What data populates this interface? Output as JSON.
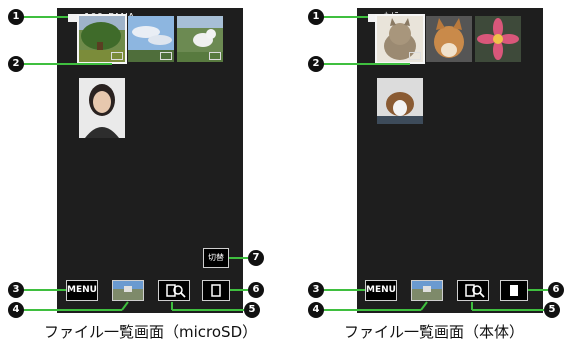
{
  "colors": {
    "leader": "#3fbf3f",
    "screen": "#1e1e1e",
    "marker": "#111111"
  },
  "left_panel": {
    "folder_name": "100_PANA",
    "menu_label": "MENU",
    "switch_label": "切替",
    "caption": "ファイル一覧画面（microSD）",
    "thumbnails": [
      "tree-photo",
      "sky-photo",
      "dog-field-photo",
      "portrait-photo"
    ]
  },
  "right_panel": {
    "folder_name": "ｶﾒﾗ",
    "menu_label": "MENU",
    "caption": "ファイル一覧画面（本体）",
    "thumbnails": [
      "cat-photo",
      "shiba-dog-photo",
      "flower-photo",
      "beagle-photo"
    ]
  },
  "markers": {
    "m1": "1",
    "m2": "2",
    "m3": "3",
    "m4": "4",
    "m5": "5",
    "m6": "6",
    "m7": "7"
  },
  "icons": {
    "camera": "camera-icon",
    "search": "search-icon",
    "phone": "phone-icon",
    "storage": "storage-icon"
  }
}
